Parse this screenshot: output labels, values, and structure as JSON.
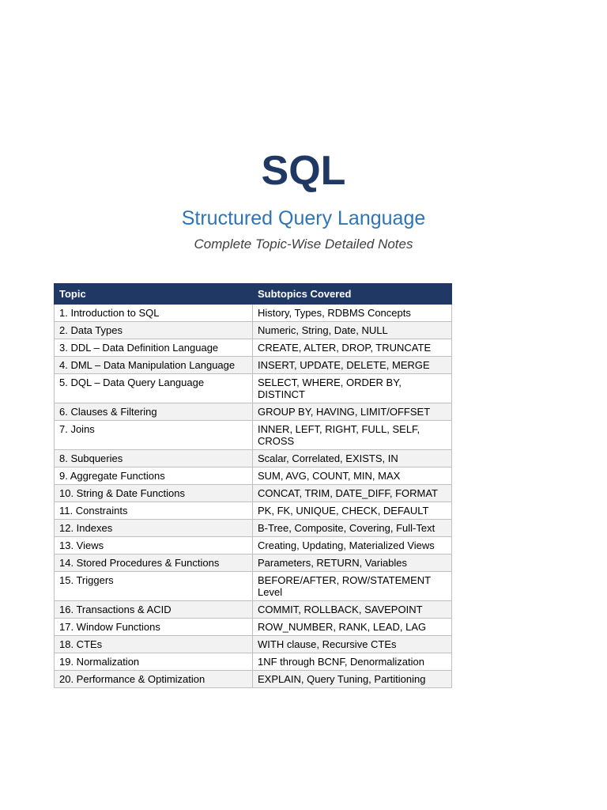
{
  "header": {
    "title": "SQL",
    "subtitle": "Structured Query Language",
    "tagline": "Complete Topic-Wise Detailed Notes"
  },
  "table": {
    "columns": [
      "Topic",
      "Subtopics Covered"
    ],
    "rows": [
      {
        "topic": "1. Introduction to SQL",
        "subtopics": "History, Types, RDBMS Concepts"
      },
      {
        "topic": "2. Data Types",
        "subtopics": "Numeric, String, Date, NULL"
      },
      {
        "topic": "3. DDL – Data Definition Language",
        "subtopics": "CREATE, ALTER, DROP, TRUNCATE"
      },
      {
        "topic": "4. DML – Data Manipulation Language",
        "subtopics": "INSERT, UPDATE, DELETE, MERGE"
      },
      {
        "topic": "5. DQL – Data Query Language",
        "subtopics": "SELECT, WHERE, ORDER BY, DISTINCT"
      },
      {
        "topic": "6. Clauses & Filtering",
        "subtopics": "GROUP BY, HAVING, LIMIT/OFFSET"
      },
      {
        "topic": "7. Joins",
        "subtopics": "INNER, LEFT, RIGHT, FULL, SELF, CROSS"
      },
      {
        "topic": "8. Subqueries",
        "subtopics": "Scalar, Correlated, EXISTS, IN"
      },
      {
        "topic": "9. Aggregate Functions",
        "subtopics": "SUM, AVG, COUNT, MIN, MAX"
      },
      {
        "topic": "10. String & Date Functions",
        "subtopics": "CONCAT, TRIM, DATE_DIFF, FORMAT"
      },
      {
        "topic": "11. Constraints",
        "subtopics": "PK, FK, UNIQUE, CHECK, DEFAULT"
      },
      {
        "topic": "12. Indexes",
        "subtopics": "B-Tree, Composite, Covering, Full-Text"
      },
      {
        "topic": "13. Views",
        "subtopics": "Creating, Updating, Materialized Views"
      },
      {
        "topic": "14. Stored Procedures & Functions",
        "subtopics": "Parameters, RETURN, Variables"
      },
      {
        "topic": "15. Triggers",
        "subtopics": "BEFORE/AFTER, ROW/STATEMENT Level"
      },
      {
        "topic": "16. Transactions & ACID",
        "subtopics": "COMMIT, ROLLBACK, SAVEPOINT"
      },
      {
        "topic": "17. Window Functions",
        "subtopics": "ROW_NUMBER, RANK, LEAD, LAG"
      },
      {
        "topic": "18. CTEs",
        "subtopics": "WITH clause, Recursive CTEs"
      },
      {
        "topic": "19. Normalization",
        "subtopics": "1NF through BCNF, Denormalization"
      },
      {
        "topic": "20. Performance & Optimization",
        "subtopics": "EXPLAIN, Query Tuning, Partitioning"
      }
    ]
  }
}
